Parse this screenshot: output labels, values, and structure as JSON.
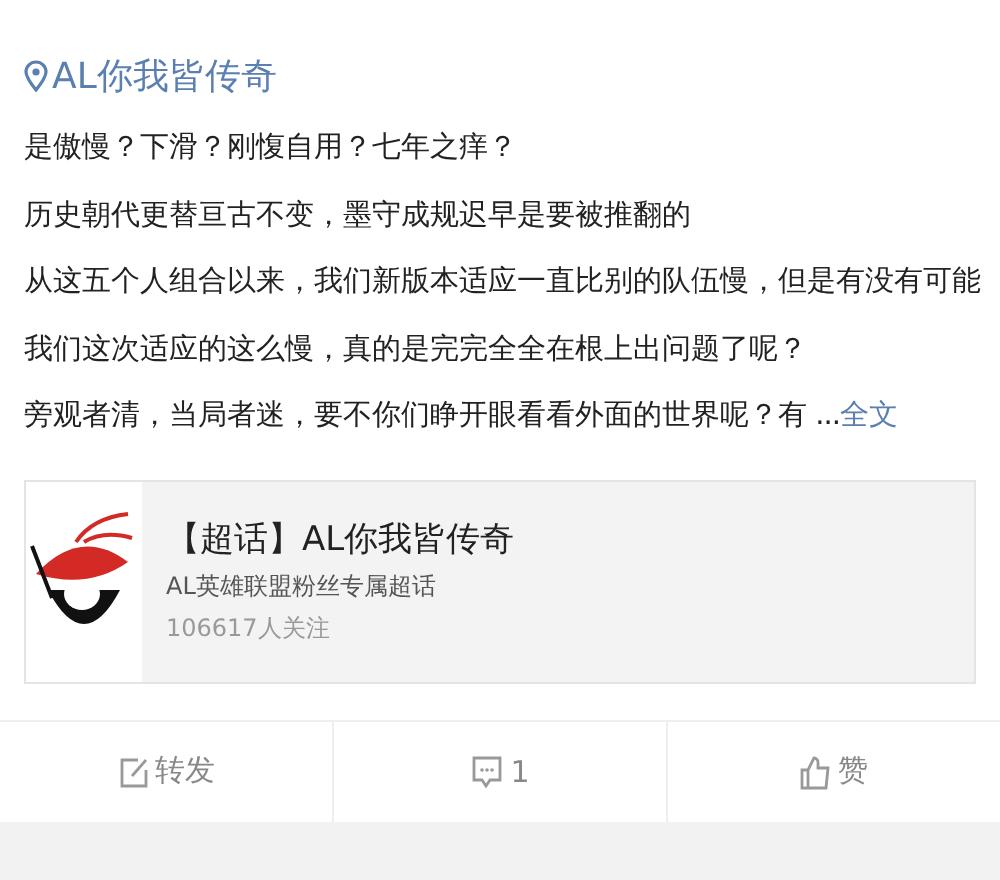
{
  "location": {
    "label": "AL你我皆传奇"
  },
  "post": {
    "lines": [
      "是傲慢？下滑？刚愎自用？七年之痒？",
      "历史朝代更替亘古不变，墨守成规迟早是要被推翻的",
      "从这五个人组合以来，我们新版本适应一直比别的队伍慢，但是有没有可能",
      "我们这次适应的这么慢，真的是完完全全在根上出问题了呢？",
      "旁观者清，当局者迷，要不你们睁开眼看看外面的世界呢？有 ..."
    ],
    "more": "全文"
  },
  "topic_card": {
    "title": "【超话】AL你我皆传奇",
    "subtitle": "AL英雄联盟粉丝专属超话",
    "followers": "106617人关注"
  },
  "actions": [
    {
      "kind": "repost",
      "label": "转发"
    },
    {
      "kind": "comment",
      "label": "1"
    },
    {
      "kind": "like",
      "label": "赞"
    }
  ]
}
